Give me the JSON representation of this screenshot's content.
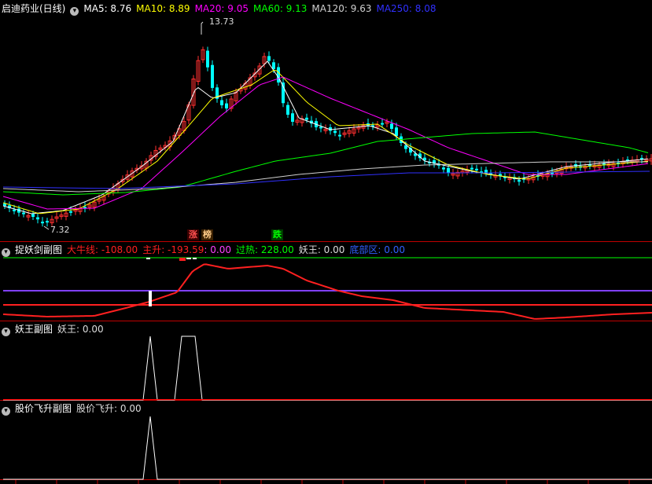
{
  "main": {
    "title": "启迪药业(日线)",
    "ma": [
      {
        "label": "MA5: 8.76",
        "color": "#ffffff"
      },
      {
        "label": "MA10: 8.89",
        "color": "#ffff00"
      },
      {
        "label": "MA20: 9.05",
        "color": "#ff00ff"
      },
      {
        "label": "MA60: 9.13",
        "color": "#00ff00"
      },
      {
        "label": "MA120: 9.63",
        "color": "#d0d0d0"
      },
      {
        "label": "MA250: 8.08",
        "color": "#3030ff"
      }
    ],
    "high_label": "13.73",
    "low_label": "7.32",
    "signals": [
      {
        "text": "涨",
        "color": "#ff5050",
        "bg": "#3a0000"
      },
      {
        "text": "榜",
        "color": "#ffcc88",
        "bg": "#3a2000"
      },
      {
        "text": "跌",
        "color": "#00ff00",
        "bg": "#003a00"
      }
    ]
  },
  "panel1": {
    "title": "捉妖剑副图",
    "items": [
      {
        "label": "大牛线: -108.00",
        "color": "#ff2020"
      },
      {
        "label": "主升: -193.59",
        "color": "#ff2020"
      },
      {
        "label": ": 0.00",
        "color": "#ff40ff"
      },
      {
        "label": "过热: 228.00",
        "color": "#00ff00"
      },
      {
        "label": "妖王: 0.00",
        "color": "#dddddd"
      },
      {
        "label": "底部区: 0.00",
        "color": "#3060ff"
      }
    ]
  },
  "panel2": {
    "title": "妖王副图",
    "items": [
      {
        "label": "妖王: 0.00",
        "color": "#dddddd"
      }
    ]
  },
  "panel3": {
    "title": "股价飞升副图",
    "items": [
      {
        "label": "股价飞升: 0.00",
        "color": "#dddddd"
      }
    ]
  },
  "colors": {
    "up": "#ff3030",
    "down": "#00ffff",
    "border": "#c00000"
  }
}
